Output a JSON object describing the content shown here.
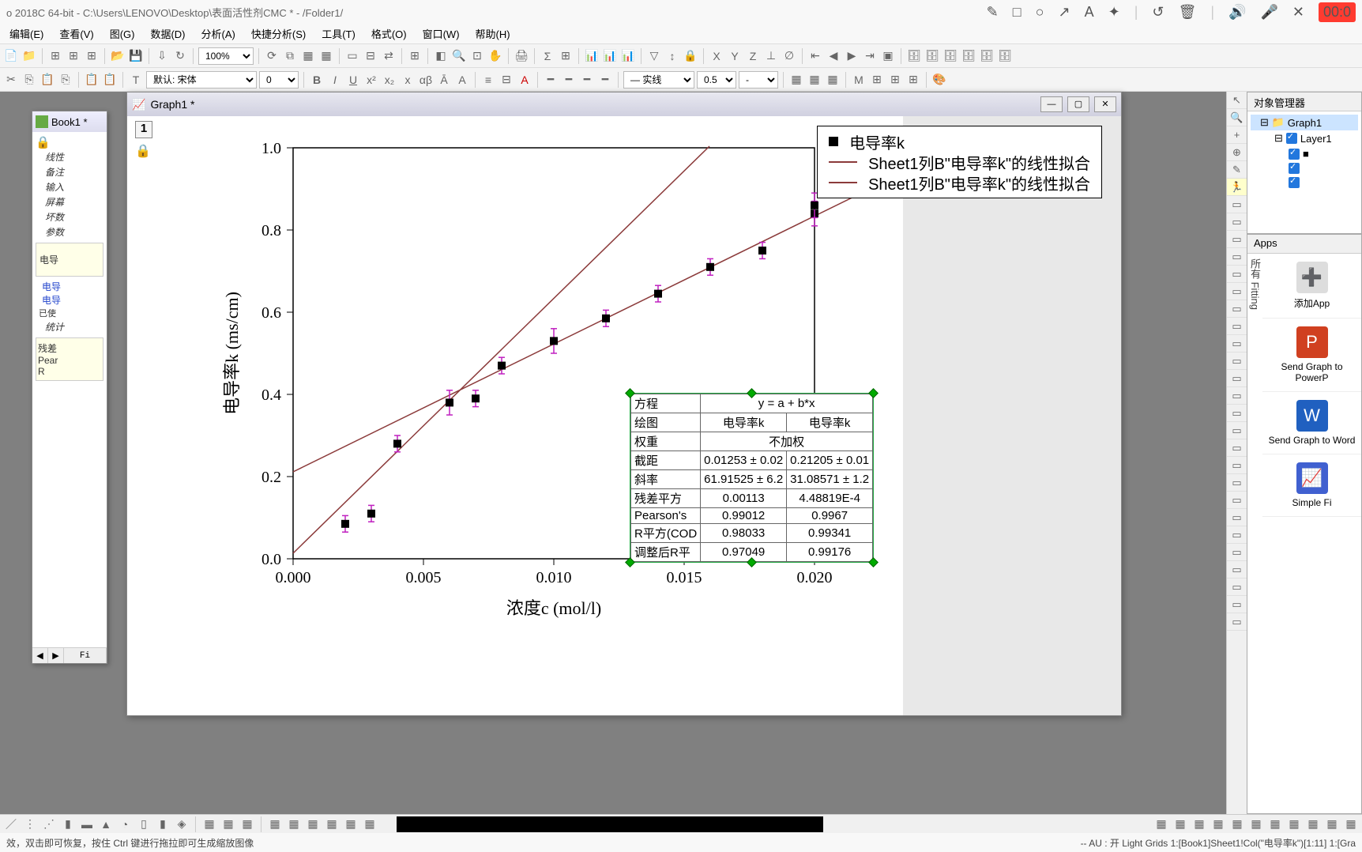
{
  "title": "o 2018C 64-bit - C:\\Users\\LENOVO\\Desktop\\表面活性剂CMC * - /Folder1/",
  "rec_time": "00:0",
  "menubar": [
    "编辑(E)",
    "查看(V)",
    "图(G)",
    "数据(D)",
    "分析(A)",
    "快捷分析(S)",
    "工具(T)",
    "格式(O)",
    "窗口(W)",
    "帮助(H)"
  ],
  "toolbar1": {
    "zoom": "100%"
  },
  "toolbar2": {
    "font_label": "默认: 宋体",
    "size": "0",
    "line_style": "— 实线",
    "line_width": "0.5",
    "marker": "-"
  },
  "book_window": {
    "title": "Book1 *",
    "tree": [
      "线性",
      "备注",
      "输入",
      "屏幕",
      "坏数",
      "参数"
    ],
    "box1": "电导",
    "links": [
      "电导",
      "电导"
    ],
    "used": "已使",
    "stat": "统计",
    "stat_items": [
      "残差",
      "Pear",
      "R",
      "   "
    ],
    "sheet": "Fi"
  },
  "graph_window": {
    "title": "Graph1 *",
    "layer": "1"
  },
  "chart_data": {
    "type": "scatter+line",
    "xlabel": "浓度c (mol/l)",
    "ylabel": "电导率k (ms/cm)",
    "xlim": [
      0,
      0.022
    ],
    "ylim": [
      0,
      1.05
    ],
    "xticks": [
      0.0,
      0.005,
      0.01,
      0.015,
      0.02
    ],
    "yticks": [
      0.0,
      0.2,
      0.4,
      0.6,
      0.8,
      1.0
    ],
    "series": [
      {
        "name": "电导率k",
        "type": "scatter",
        "x": [
          0.002,
          0.003,
          0.004,
          0.006,
          0.007,
          0.008,
          0.01,
          0.012,
          0.014,
          0.016,
          0.018,
          0.02,
          0.02
        ],
        "y": [
          0.085,
          0.11,
          0.28,
          0.38,
          0.39,
          0.47,
          0.53,
          0.585,
          0.645,
          0.71,
          0.75,
          0.84,
          0.86
        ],
        "yerr": [
          0.02,
          0.02,
          0.02,
          0.03,
          0.02,
          0.02,
          0.03,
          0.02,
          0.02,
          0.02,
          0.02,
          0.03,
          0.03
        ]
      },
      {
        "name": "Sheet1列B\"电导率k\"的线性拟合",
        "type": "line",
        "slope": 61.91525,
        "intercept": 0.01253
      },
      {
        "name": "Sheet1列B\"电导率k\"的线性拟合",
        "type": "line",
        "slope": 31.08571,
        "intercept": 0.21205
      }
    ],
    "legend": [
      "电导率k",
      "Sheet1列B\"电导率k\"的线性拟合",
      "Sheet1列B\"电导率k\"的线性拟合"
    ]
  },
  "fit_table": {
    "equation": "y = a + b*x",
    "cols": [
      "电导率k",
      "电导率k"
    ],
    "rows": [
      {
        "label": "方程"
      },
      {
        "label": "绘图"
      },
      {
        "label": "权重",
        "span": "不加权"
      },
      {
        "label": "截距",
        "v1": "0.01253 ± 0.02",
        "v2": "0.21205 ± 0.01"
      },
      {
        "label": "斜率",
        "v1": "61.91525 ± 6.2",
        "v2": "31.08571 ± 1.2"
      },
      {
        "label": "残差平方",
        "v1": "0.00113",
        "v2": "4.48819E-4"
      },
      {
        "label": "Pearson's",
        "v1": "0.99012",
        "v2": "0.9967"
      },
      {
        "label": "R平方(COD",
        "v1": "0.98033",
        "v2": "0.99341"
      },
      {
        "label": "调整后R平",
        "v1": "0.97049",
        "v2": "0.99176"
      }
    ]
  },
  "obj_manager": {
    "title": "对象管理器",
    "root": "Graph1",
    "layer": "Layer1"
  },
  "apps": {
    "title": "Apps",
    "side": "所有   Fitting",
    "items": [
      "添加App",
      "Send Graph to PowerP",
      "Send Graph to Word",
      "Simple Fi"
    ]
  },
  "statusbar": {
    "left": "效，双击即可恢复，按住 Ctrl 键进行拖拉即可生成缩放图像",
    "right": "--   AU : 开  Light Grids  1:[Book1]Sheet1!Col(\"电导率k\")[1:11]  1:[Gra"
  }
}
